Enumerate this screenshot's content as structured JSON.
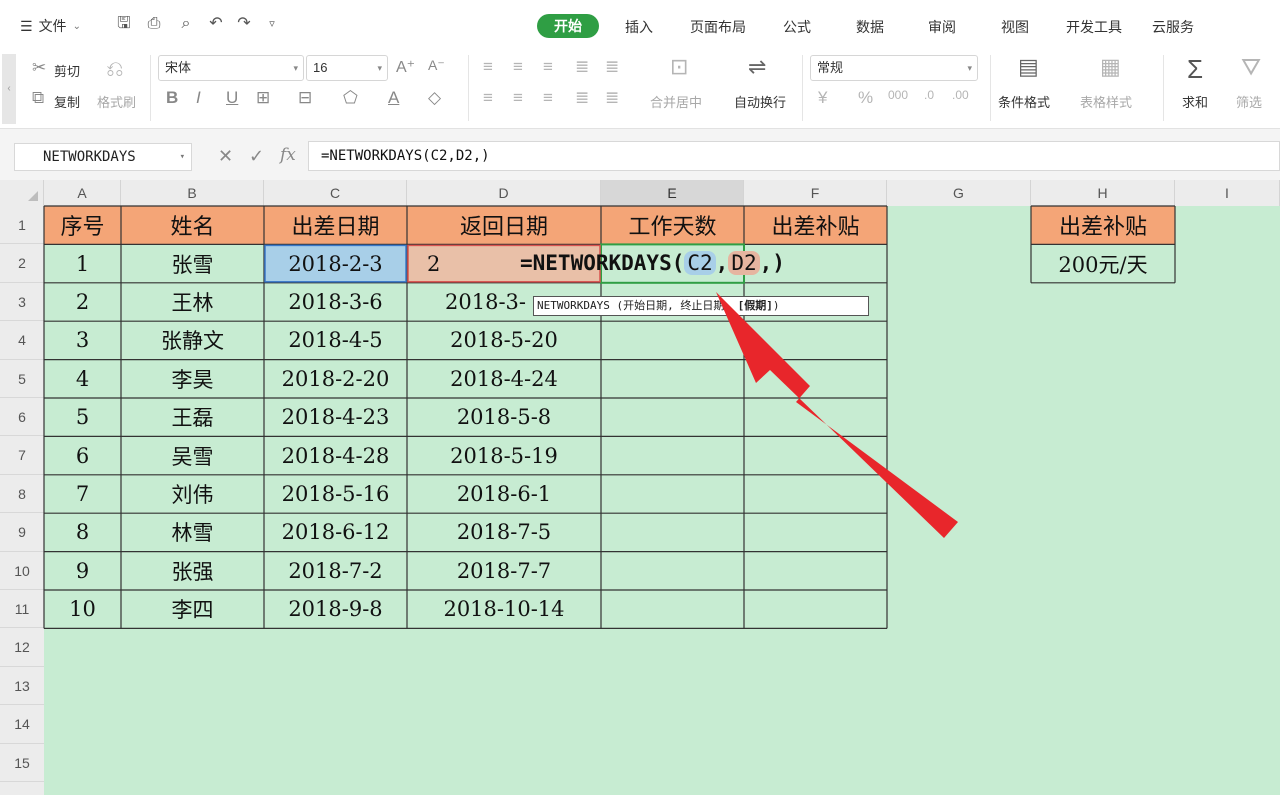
{
  "menu": {
    "file_label": "文件",
    "tabs": [
      "开始",
      "插入",
      "页面布局",
      "公式",
      "数据",
      "审阅",
      "视图",
      "开发工具",
      "云服务"
    ],
    "active_tab": "开始"
  },
  "ribbon": {
    "cut": "剪切",
    "copy": "复制",
    "format_painter": "格式刷",
    "font_name": "宋体",
    "font_size": "16",
    "merge_center": "合并居中",
    "wrap_text": "自动换行",
    "number_format": "常规",
    "conditional_format": "条件格式",
    "table_style": "表格样式",
    "sum": "求和",
    "filter": "筛选"
  },
  "formula_bar": {
    "name_box": "NETWORKDAYS",
    "formula": "=NETWORKDAYS(C2,D2,)"
  },
  "sheet": {
    "columns": [
      "A",
      "B",
      "C",
      "D",
      "E",
      "F",
      "G",
      "H",
      "I"
    ],
    "rows": [
      "1",
      "2",
      "3",
      "4",
      "5",
      "6",
      "7",
      "8",
      "9",
      "10",
      "11",
      "12",
      "13",
      "14",
      "15"
    ],
    "headers": [
      "序号",
      "姓名",
      "出差日期",
      "返回日期",
      "工作天数",
      "出差补贴"
    ],
    "data": [
      [
        "1",
        "张雪",
        "2018-2-3",
        "2"
      ],
      [
        "2",
        "王林",
        "2018-3-6",
        "2018-3-"
      ],
      [
        "3",
        "张静文",
        "2018-4-5",
        "2018-5-20"
      ],
      [
        "4",
        "李昊",
        "2018-2-20",
        "2018-4-24"
      ],
      [
        "5",
        "王磊",
        "2018-4-23",
        "2018-5-8"
      ],
      [
        "6",
        "吴雪",
        "2018-4-28",
        "2018-5-19"
      ],
      [
        "7",
        "刘伟",
        "2018-5-16",
        "2018-6-1"
      ],
      [
        "8",
        "林雪",
        "2018-6-12",
        "2018-7-5"
      ],
      [
        "9",
        "张强",
        "2018-7-2",
        "2018-7-7"
      ],
      [
        "10",
        "李四",
        "2018-9-8",
        "2018-10-14"
      ]
    ],
    "allowance_header": "出差补贴",
    "allowance_value": "200元/天"
  },
  "editing": {
    "prefix": "=NETWORKDAYS(",
    "ref1": "C2",
    "comma1": ",",
    "ref2": "D2",
    "suffix": ",)",
    "tooltip_fn": "NETWORKDAYS (",
    "tooltip_a": "开始日期",
    "tooltip_b": ", 终止日期, ",
    "tooltip_c": "[假期]",
    "tooltip_end": ")"
  },
  "colors": {
    "accent": "#2f9e44",
    "sheet_bg": "#c7ecd2",
    "header_fill": "#f4a577",
    "arrow": "#e8262b"
  }
}
